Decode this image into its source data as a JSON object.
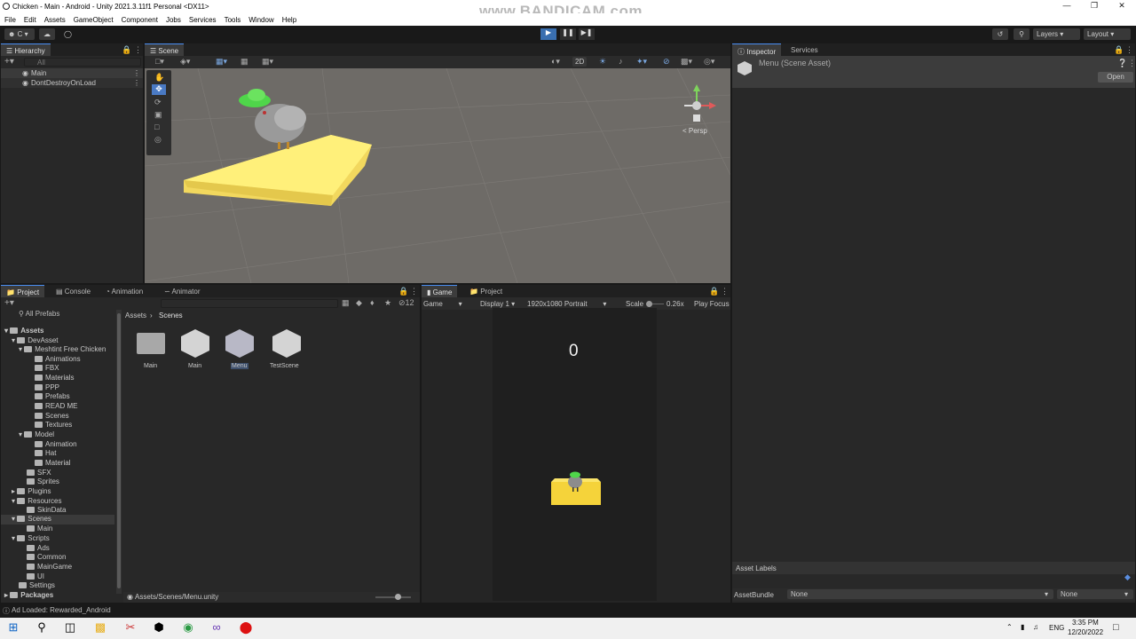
{
  "window": {
    "title": "Chicken - Main - Android - Unity 2021.3.11f1 Personal <DX11>",
    "watermark": "www.BANDICAM.com"
  },
  "menu": [
    "File",
    "Edit",
    "Assets",
    "GameObject",
    "Component",
    "Jobs",
    "Services",
    "Tools",
    "Window",
    "Help"
  ],
  "toolbar": {
    "account": "C",
    "layers": "Layers",
    "layout": "Layout"
  },
  "hierarchy": {
    "tab": "Hierarchy",
    "search_placeholder": "All",
    "items": [
      "Main",
      "DontDestroyOnLoad"
    ]
  },
  "scene": {
    "tab": "Scene",
    "mode_2d": "2D",
    "persp": "< Persp"
  },
  "project": {
    "tabs": [
      "Project",
      "Console",
      "Animation",
      "Animator"
    ],
    "favorites": "All Prefabs",
    "breadcrumb": [
      "Assets",
      "Scenes"
    ],
    "tree": [
      "Assets",
      "DevAsset",
      "Meshtint Free Chicken",
      "Animations",
      "FBX",
      "Materials",
      "PPP",
      "Prefabs",
      "READ ME",
      "Scenes",
      "Textures",
      "Model",
      "Animation",
      "Hat",
      "Material",
      "SFX",
      "Sprites",
      "Plugins",
      "Resources",
      "SkinData",
      "Scenes",
      "Main",
      "Scripts",
      "Ads",
      "Common",
      "MainGame",
      "UI",
      "Settings",
      "Packages"
    ],
    "assets": [
      "Main",
      "Main",
      "Menu",
      "TestScene"
    ],
    "count": "12",
    "path": "Assets/Scenes/Menu.unity"
  },
  "game": {
    "tabs": [
      "Game",
      "Project"
    ],
    "display": "Display 1",
    "mode": "Game",
    "resolution": "1920x1080 Portrait",
    "scale_label": "Scale",
    "scale_value": "0.26x",
    "play_focus": "Play Focus",
    "score": "0"
  },
  "inspector": {
    "tabs": [
      "Inspector",
      "Services"
    ],
    "title": "Menu (Scene Asset)",
    "open": "Open",
    "asset_labels": "Asset Labels",
    "asset_bundle": "AssetBundle",
    "bundle_value": "None",
    "variant_value": "None"
  },
  "status": {
    "message": "Ad Loaded: Rewarded_Android"
  },
  "taskbar": {
    "lang": "ENG",
    "time": "3:35 PM",
    "date": "12/20/2022"
  }
}
